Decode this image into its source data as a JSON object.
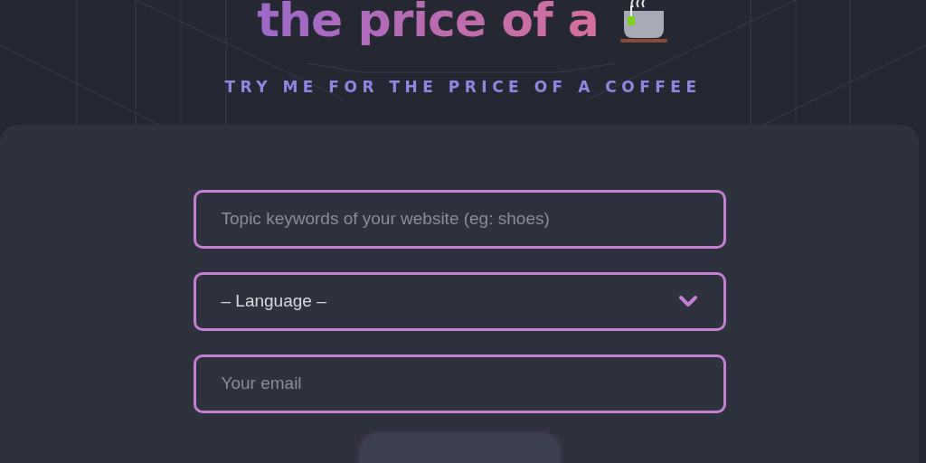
{
  "hero": {
    "heading": "the price of a",
    "subtitle": "TRY ME FOR THE PRICE OF A COFFEE"
  },
  "form": {
    "keywords": {
      "placeholder": "Topic keywords of your website (eg: shoes)"
    },
    "language": {
      "value": "– Language –"
    },
    "email": {
      "placeholder": "Your email"
    }
  }
}
